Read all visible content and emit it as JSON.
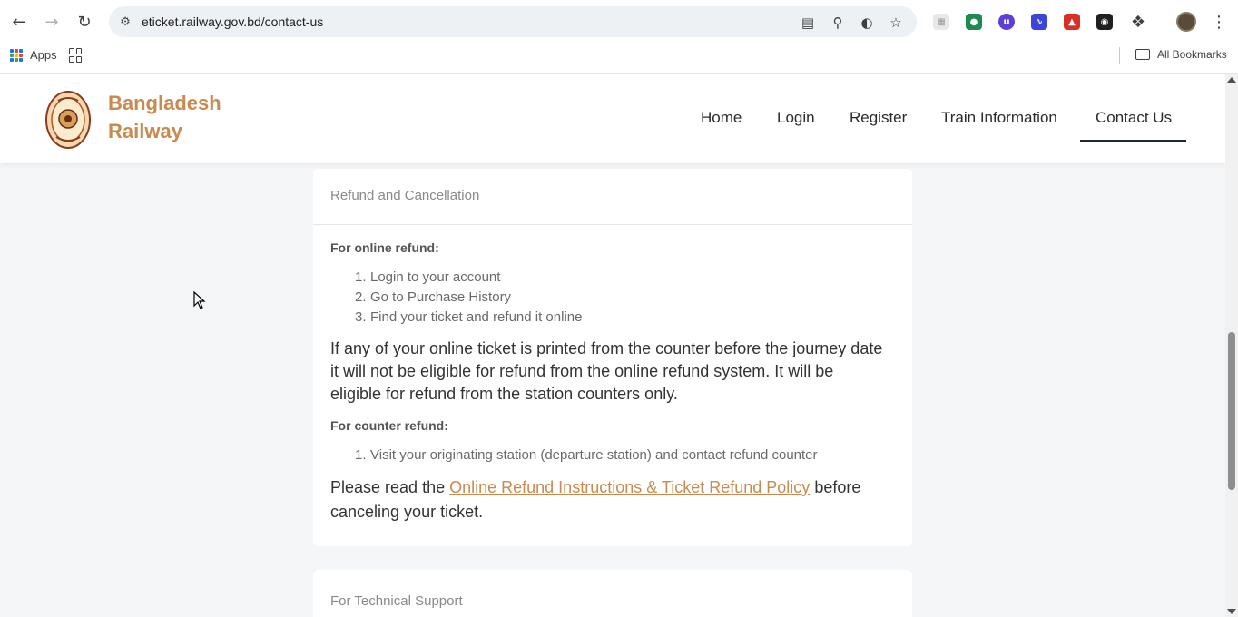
{
  "browser": {
    "url": "eticket.railway.gov.bd/contact-us",
    "bookmarks_bar": {
      "apps_label": "Apps",
      "all_bookmarks_label": "All Bookmarks"
    },
    "extension_colors": [
      "#e8e8e8",
      "#1e8a4e",
      "#5b3fd6",
      "#3b45d9",
      "#d93025",
      "#202020"
    ]
  },
  "site": {
    "brand": "Bangladesh Railway",
    "brand_color": "#c98a4f",
    "nav": {
      "items": [
        "Home",
        "Login",
        "Register",
        "Train Information",
        "Contact Us"
      ],
      "active": "Contact Us"
    }
  },
  "refund_card": {
    "title": "Refund and Cancellation",
    "online_heading": "For online refund:",
    "online_steps": [
      "Login to your account",
      "Go to Purchase History",
      "Find your ticket and refund it online"
    ],
    "notice_line_1": "If any of your online ticket is printed from the counter before the journey date",
    "notice_line_2": "it will not be eligible for refund from the online refund system. It will be",
    "notice_line_3": "eligible for refund from the station counters only.",
    "counter_heading": "For counter refund:",
    "counter_steps": [
      "Visit your originating station (departure station) and contact refund counter"
    ],
    "policy_prefix": "Please read the",
    "policy_link": "Online Refund Instructions & Ticket Refund Policy",
    "policy_suffix_1": "before",
    "policy_suffix_2": "canceling your ticket."
  },
  "support_card": {
    "title": "For Technical Support"
  }
}
